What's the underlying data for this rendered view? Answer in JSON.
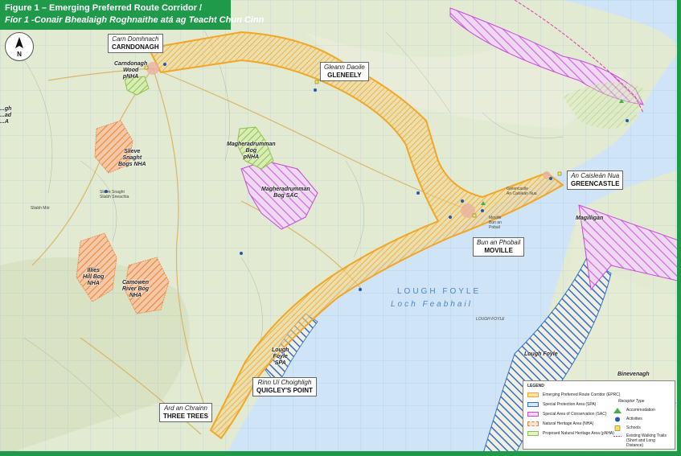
{
  "header": {
    "title_en": "Figure 1 – Emerging Preferred Route Corridor /",
    "title_ga": "Fíor 1 -Conair Bhealaigh Roghnaithe atá ag Teacht Chun Cinn"
  },
  "north_arrow": {
    "label": "N"
  },
  "towns": [
    {
      "ga": "Carn Domhnach",
      "en": "CARNDONAGH"
    },
    {
      "ga": "Gleann Daoile",
      "en": "GLENEELY"
    },
    {
      "ga": "An Caisleán Nua",
      "en": "GREENCASTLE"
    },
    {
      "ga": "Bun an Phobail",
      "en": "MOVILLE"
    },
    {
      "ga": "Rinn Uí Choighligh",
      "en": "QUIGLEY'S POINT"
    },
    {
      "ga": "Ard an Chrainn",
      "en": "THREE TREES"
    }
  ],
  "sites": {
    "carndonagh_wood": "Carndonagh\nWood\npNHA",
    "slieve_snaght": "Slieve\nSnaght\nBogs NHA",
    "magheradrumman_pnha": "Magheradrumman\nBog\npNHA",
    "magheradrumman_sac": "Magheradrumman\nBog SAC",
    "illies_hill": "Illies\nHill Bog\nNHA",
    "camowen": "Camowen\nRiver Bog\nNHA",
    "lough_foyle_spa": "Lough\nFoyle\nSPA",
    "lough_foyle": "Lough Foyle",
    "magilligan": "Magilligan",
    "binevenagh": "Binevenagh",
    "partial_left": "...gh\n...ad\n...A"
  },
  "map_text": {
    "lough_foyle_en": "LOUGH FOYLE",
    "lough_foyle_ga": "Loch Feabhail",
    "lough_foyle_small": "LOUGH FOYLE",
    "greencastle_small": "Greencastle\nAn Caisleán Nua",
    "moville_small": "Moville\nBun an\nPobail",
    "slieve_snaght_small": "Slieve Snaght\nSliabh Sneachta",
    "sliabh_mor": "Sliabh Mór"
  },
  "legend": {
    "title": "LEGEND",
    "receptor_title": "Receptor Type",
    "items": [
      {
        "label": "Emerging Preferred Route Corridor (EPRC)",
        "color": "#f2a623"
      },
      {
        "label": "Special Protection Area (SPA)",
        "color": "#2f6fd1"
      },
      {
        "label": "Special Area of Conservation (SAC)",
        "color": "#c54bd8"
      },
      {
        "label": "Natural Heritage Area (NHA)",
        "color": "#e8823a"
      },
      {
        "label": "Proposed Natural Heritage Area (pNHA)",
        "color": "#8fc24a"
      }
    ],
    "receptors": [
      {
        "label": "Accommodation",
        "icon": "triangle-icon",
        "color": "#3fb24a"
      },
      {
        "label": "Activities",
        "icon": "circle-icon",
        "color": "#2257b8"
      },
      {
        "label": "Schools",
        "icon": "square-icon",
        "color": "#f5e642"
      },
      {
        "label": "Existing Walking Trails (Short and Long Distance)",
        "icon": "dashed-line-icon",
        "color": "#e23aa6"
      }
    ]
  }
}
